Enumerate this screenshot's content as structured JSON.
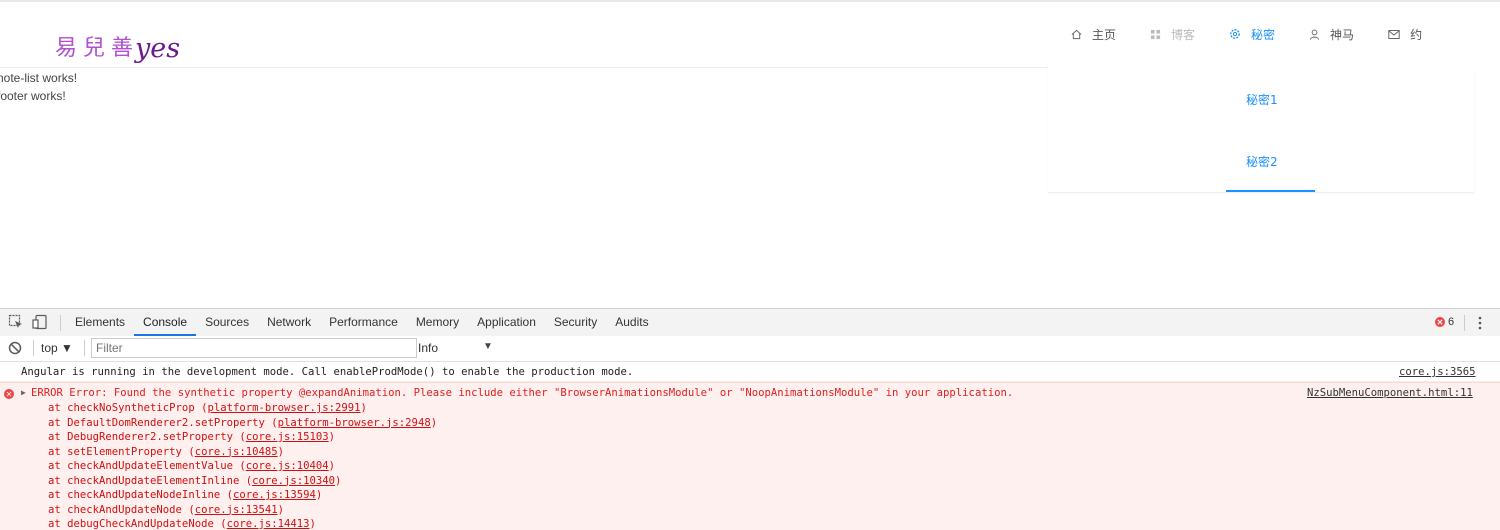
{
  "logo": {
    "cn": "易兒善",
    "en": "yes"
  },
  "page_text": {
    "line1": "note-list works!",
    "line2": "footer works!"
  },
  "nav": {
    "items": [
      {
        "label": "主页",
        "icon": "home-icon"
      },
      {
        "label": "博客",
        "icon": "grid-icon",
        "disabled": true
      },
      {
        "label": "秘密",
        "icon": "gear-icon",
        "active": true
      },
      {
        "label": "神马",
        "icon": "user-icon"
      },
      {
        "label": "约",
        "icon": "mail-icon"
      }
    ],
    "submenu": [
      {
        "label": "秘密1"
      },
      {
        "label": "秘密2",
        "selected": true
      }
    ]
  },
  "devtools": {
    "tabs": [
      "Elements",
      "Console",
      "Sources",
      "Network",
      "Performance",
      "Memory",
      "Application",
      "Security",
      "Audits"
    ],
    "active_tab": "Console",
    "error_count": "6",
    "context": "top ▼",
    "filter_placeholder": "Filter",
    "level": "Info",
    "level_arrow": "▼",
    "info_message": {
      "text": "Angular is running in the development mode. Call enableProdMode() to enable the production mode.",
      "source": "core.js:3565"
    },
    "error_message": {
      "text": "ERROR Error: Found the synthetic property @expandAnimation. Please include either \"BrowserAnimationsModule\" or \"NoopAnimationsModule\" in your application.",
      "source": "NzSubMenuComponent.html:11",
      "stack": [
        {
          "fn": "at checkNoSyntheticProp",
          "loc": "platform-browser.js:2991"
        },
        {
          "fn": "at DefaultDomRenderer2.setProperty",
          "loc": "platform-browser.js:2948"
        },
        {
          "fn": "at DebugRenderer2.setProperty",
          "loc": "core.js:15103"
        },
        {
          "fn": "at setElementProperty",
          "loc": "core.js:10485"
        },
        {
          "fn": "at checkAndUpdateElementValue",
          "loc": "core.js:10404"
        },
        {
          "fn": "at checkAndUpdateElementInline",
          "loc": "core.js:10340"
        },
        {
          "fn": "at checkAndUpdateNodeInline",
          "loc": "core.js:13594"
        },
        {
          "fn": "at checkAndUpdateNode",
          "loc": "core.js:13541"
        },
        {
          "fn": "at debugCheckAndUpdateNode",
          "loc": "core.js:14413"
        }
      ]
    },
    "colors": {
      "accent": "#1a73e8",
      "error_text": "#e02020",
      "error_bg": "#fff0f0"
    }
  }
}
